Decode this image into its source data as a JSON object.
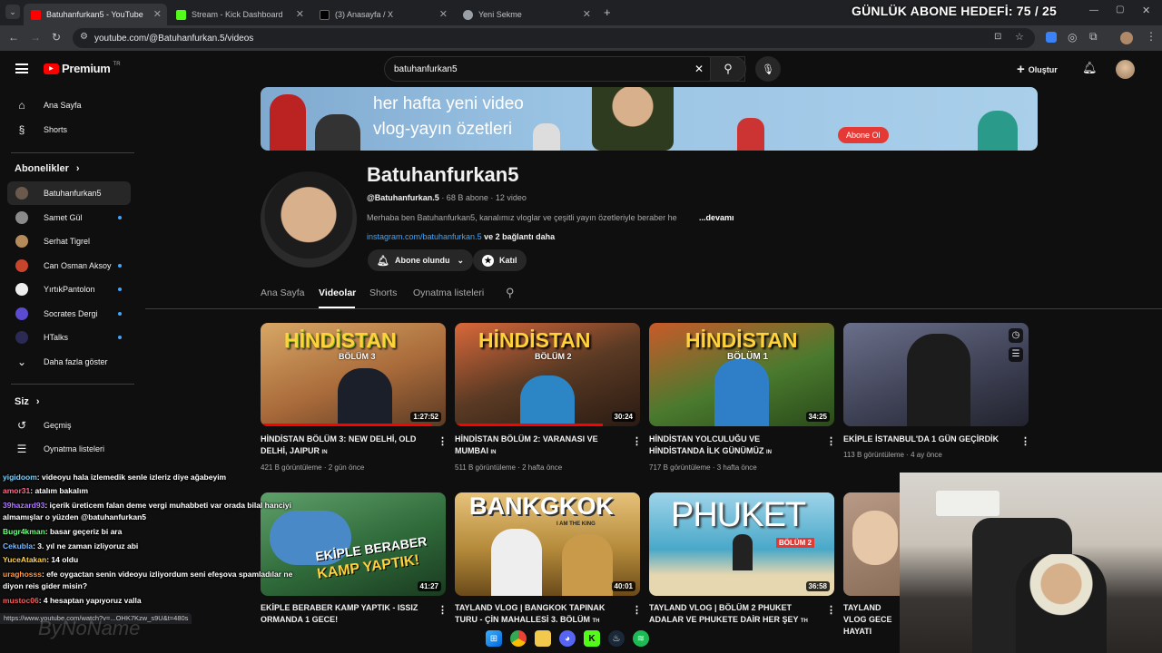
{
  "browser": {
    "tabs": [
      {
        "title": "Batuhanfurkan5 - YouTube",
        "color": "#ff0000"
      },
      {
        "title": "Stream - Kick Dashboard",
        "color": "#53fc18"
      },
      {
        "title": "(3) Anasayfa / X",
        "color": "#000000"
      },
      {
        "title": "Yeni Sekme",
        "color": "#9aa0a6"
      }
    ],
    "url": "youtube.com/@Batuhanfurkan.5/videos",
    "status_url": "https://www.youtube.com/watch?v=...OHK7Kzw_s9U&t=480s"
  },
  "overlay": {
    "goal": "GÜNLÜK ABONE HEDEFİ: 75 / 25",
    "watermark": "ByNoName"
  },
  "header": {
    "logo": "Premium",
    "logo_region": "TR",
    "search_value": "batuhanfurkan5",
    "create_label": "Oluştur"
  },
  "sidebar": {
    "nav": [
      {
        "label": "Ana Sayfa",
        "icon": "home-icon"
      },
      {
        "label": "Shorts",
        "icon": "shorts-icon"
      }
    ],
    "subs_heading": "Abonelikler",
    "subs": [
      {
        "label": "Batuhanfurkan5",
        "color": "#6b5a4c",
        "dot": false
      },
      {
        "label": "Samet Gül",
        "color": "#8a8a8a",
        "dot": true
      },
      {
        "label": "Serhat Tigrel",
        "color": "#b58b5a",
        "dot": false
      },
      {
        "label": "Can Osman Aksoy",
        "color": "#c7452b",
        "dot": true
      },
      {
        "label": "YırtıkPantolon",
        "color": "#eeeeee",
        "dot": true
      },
      {
        "label": "Socrates Dergi",
        "color": "#5b4bd1",
        "dot": true
      },
      {
        "label": "HTalks",
        "color": "#2a2a55",
        "dot": true
      }
    ],
    "more": "Daha fazla göster",
    "you_heading": "Siz",
    "you": [
      {
        "label": "Geçmiş",
        "icon": "history-icon"
      },
      {
        "label": "Oynatma listeleri",
        "icon": "playlists-icon"
      }
    ]
  },
  "banner": {
    "line1": "her hafta yeni video",
    "line2": "vlog-yayın özetleri",
    "button": "Abone Ol"
  },
  "channel": {
    "name": "Batuhanfurkan5",
    "handle": "@Batuhanfurkan.5",
    "stats": "· 68 B abone · 12 video",
    "description": "Merhaba ben Batuhanfurkan5, kanalımız vloglar ve çeşitli yayın özetleriyle beraber he",
    "more": "...devamı",
    "link": "instagram.com/batuhanfurkan.5",
    "link_more": "ve 2 bağlantı daha",
    "subscribed_label": "Abone olundu",
    "join_label": "Katıl"
  },
  "channel_tabs": [
    "Ana Sayfa",
    "Videolar",
    "Shorts",
    "Oynatma listeleri"
  ],
  "videos": [
    {
      "thumb_text": "HİNDİSTAN",
      "thumb_sub": "BÖLÜM 3",
      "duration": "1:27:52",
      "title": "HİNDİSTAN BÖLÜM 3: NEW DELHİ, OLD DELHİ, JAIPUR",
      "badge": "IN",
      "views": "421 B görüntüleme",
      "age": "2 gün önce",
      "progress": 0.92,
      "bg": "#a86a3a"
    },
    {
      "thumb_text": "HİNDİSTAN",
      "thumb_sub": "BÖLÜM 2",
      "duration": "30:24",
      "title": "HİNDİSTAN BÖLÜM 2: VARANASI VE MUMBAI",
      "badge": "IN",
      "views": "511 B görüntüleme",
      "age": "2 hafta önce",
      "progress": 0.8,
      "bg": "#5a3a24"
    },
    {
      "thumb_text": "HİNDİSTAN",
      "thumb_sub": "BÖLÜM 1",
      "duration": "34:25",
      "title": "HİNDİSTAN YOLCULUĞU VE HİNDİSTANDA İLK GÜNÜMÜZ",
      "badge": "IN",
      "views": "717 B görüntüleme",
      "age": "3 hafta önce",
      "progress": 0.0,
      "bg": "#4a7a2e"
    },
    {
      "thumb_text": "",
      "thumb_sub": "",
      "duration": "",
      "title": "EKİPLE İSTANBUL'DA 1 GÜN GEÇİRDİK",
      "badge": "",
      "views": "113 B görüntüleme",
      "age": "4 ay önce",
      "progress": 0.0,
      "bg": "#3c3f52"
    },
    {
      "thumb_text": "EKİPLE BERABER",
      "thumb_sub": "KAMP YAPTIK!",
      "duration": "41:27",
      "title": "EKİPLE BERABER KAMP YAPTIK - ISSIZ ORMANDA 1 GECE!",
      "badge": "",
      "views": "",
      "age": "",
      "progress": 0.0,
      "bg": "#2f6a3a"
    },
    {
      "thumb_text": "BANKGKOK",
      "thumb_sub": "I AM THE KING",
      "duration": "40:01",
      "title": "TAYLAND VLOG | BANGKOK TAPINAK TURU - ÇİN MAHALLESİ 3. BÖLÜM",
      "badge": "TH",
      "views": "",
      "age": "",
      "progress": 0.0,
      "bg": "#b48a3a"
    },
    {
      "thumb_text": "PHUKET",
      "thumb_sub": "BÖLÜM 2",
      "duration": "36:58",
      "title": "TAYLAND VLOG | BÖLÜM 2 PHUKET ADALAR VE PHUKETE DAİR HER ŞEY",
      "badge": "TH",
      "views": "",
      "age": "",
      "progress": 0.0,
      "bg": "#49a8c8"
    },
    {
      "thumb_text": "",
      "thumb_sub": "",
      "duration": "",
      "title": "TAYLAND VLOG GECE HAYATI",
      "badge": "",
      "views": "",
      "age": "",
      "progress": 0.0,
      "bg": "#8a6e5a"
    }
  ],
  "chat": [
    {
      "user": "yigidoom",
      "msg": ": videoyu hala izlemedik senle izleriz diye ağabeyim",
      "color": "#7bd3ff"
    },
    {
      "user": "amor31",
      "msg": ": atalım bakalım",
      "color": "#ff6b8b"
    },
    {
      "user": "39hazard93",
      "msg": ": içerik üreticem falan deme vergi muhabbeti var orada bilal hanciyi",
      "color": "#b07bff"
    },
    {
      "user": "",
      "msg": "almamışlar o yüzden @batuhanfurkan5",
      "color": "#ffffff"
    },
    {
      "user": "Bugr4kman",
      "msg": ": basar geçeriz bi ara",
      "color": "#6bff7b"
    },
    {
      "user": "Cekubla",
      "msg": ": 3. yıl ne zaman izliyoruz abi",
      "color": "#7bb8ff"
    },
    {
      "user": "YuceAtakan",
      "msg": ": 14 oldu",
      "color": "#ffd14a"
    },
    {
      "user": "uraghosss",
      "msg": ": efe oygactan senin videoyu izliyordum seni efeşova spamladılar ne",
      "color": "#ff9a4a"
    },
    {
      "user": "",
      "msg": "diyon reis gider misin?",
      "color": "#ffffff"
    },
    {
      "user": "mustoc06",
      "msg": ": 4 hesaptan yapıyoruz valla",
      "color": "#ff5b5b"
    }
  ]
}
